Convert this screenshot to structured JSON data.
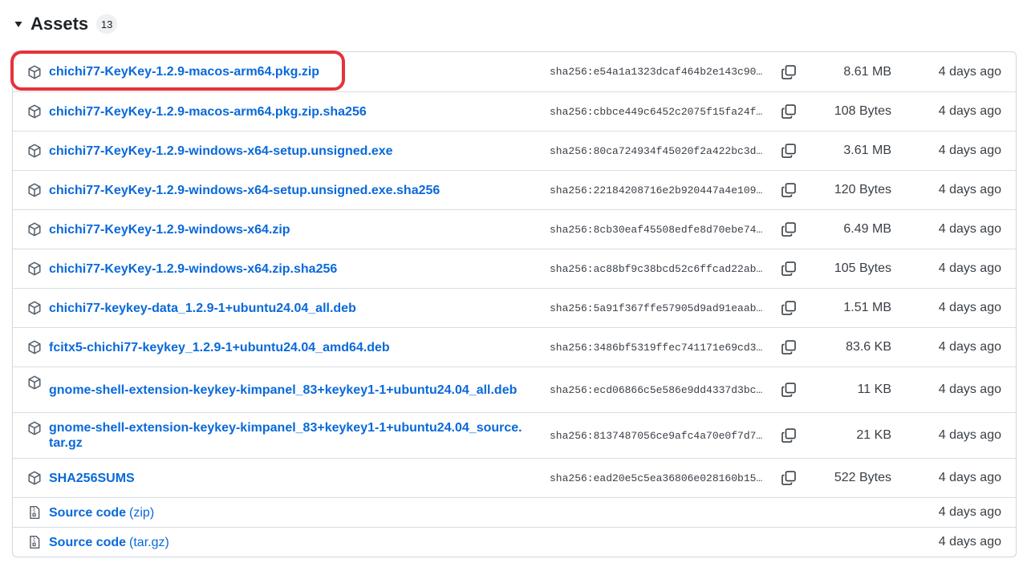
{
  "assets": {
    "title": "Assets",
    "count": "13",
    "rows": [
      {
        "name": "chichi77-KeyKey-1.2.9-macos-arm64.pkg.zip",
        "digest": "sha256:e54a1a1323dcaf464b2e143c90…",
        "size": "8.61 MB",
        "date": "4 days ago",
        "icon": "package-icon"
      },
      {
        "name": "chichi77-KeyKey-1.2.9-macos-arm64.pkg.zip.sha256",
        "digest": "sha256:cbbce449c6452c2075f15fa24f…",
        "size": "108 Bytes",
        "date": "4 days ago",
        "icon": "package-icon"
      },
      {
        "name": "chichi77-KeyKey-1.2.9-windows-x64-setup.unsigned.exe",
        "digest": "sha256:80ca724934f45020f2a422bc3d…",
        "size": "3.61 MB",
        "date": "4 days ago",
        "icon": "package-icon"
      },
      {
        "name": "chichi77-KeyKey-1.2.9-windows-x64-setup.unsigned.exe.sha256",
        "digest": "sha256:22184208716e2b920447a4e109…",
        "size": "120 Bytes",
        "date": "4 days ago",
        "icon": "package-icon"
      },
      {
        "name": "chichi77-KeyKey-1.2.9-windows-x64.zip",
        "digest": "sha256:8cb30eaf45508edfe8d70ebe74…",
        "size": "6.49 MB",
        "date": "4 days ago",
        "icon": "package-icon"
      },
      {
        "name": "chichi77-KeyKey-1.2.9-windows-x64.zip.sha256",
        "digest": "sha256:ac88bf9c38bcd52c6ffcad22ab…",
        "size": "105 Bytes",
        "date": "4 days ago",
        "icon": "package-icon"
      },
      {
        "name": "chichi77-keykey-data_1.2.9-1+ubuntu24.04_all.deb",
        "digest": "sha256:5a91f367ffe57905d9ad91eaab…",
        "size": "1.51 MB",
        "date": "4 days ago",
        "icon": "package-icon"
      },
      {
        "name": "fcitx5-chichi77-keykey_1.2.9-1+ubuntu24.04_amd64.deb",
        "digest": "sha256:3486bf5319ffec741171e69cd3…",
        "size": "83.6 KB",
        "date": "4 days ago",
        "icon": "package-icon"
      },
      {
        "name": "gnome-shell-extension-keykey-kimpanel_83+keykey1-1+ubuntu24.04_all.deb",
        "digest": "sha256:ecd06866c5e586e9dd4337d3bc…",
        "size": "11 KB",
        "date": "4 days ago",
        "icon": "package-icon"
      },
      {
        "name": "gnome-shell-extension-keykey-kimpanel_83+keykey1-1+ubuntu24.04_source.tar.gz",
        "digest": "sha256:8137487056ce9afc4a70e0f7d7…",
        "size": "21 KB",
        "date": "4 days ago",
        "icon": "package-icon"
      },
      {
        "name": "SHA256SUMS",
        "digest": "sha256:ead20e5c5ea36806e028160b15…",
        "size": "522 Bytes",
        "date": "4 days ago",
        "icon": "package-icon"
      },
      {
        "name": "Source code",
        "kind": "(zip)",
        "digest": "",
        "size": "",
        "date": "4 days ago",
        "icon": "file-zip-icon"
      },
      {
        "name": "Source code",
        "kind": "(tar.gz)",
        "digest": "",
        "size": "",
        "date": "4 days ago",
        "icon": "file-zip-icon"
      }
    ]
  },
  "colors": {
    "link": "#0969da",
    "highlight": "#e5323a",
    "border": "#d0d7de"
  }
}
